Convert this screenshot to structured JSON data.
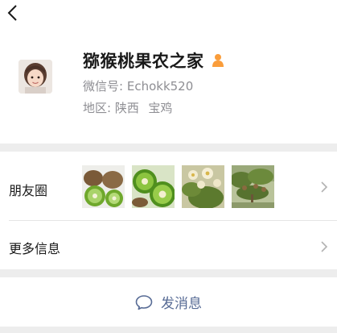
{
  "nav": {
    "back_icon": "chevron-left-icon"
  },
  "profile": {
    "name": "猕猴桃果农之家",
    "gender_icon": "person-icon",
    "gender_color": "#fa9d3b",
    "wechat_id_label": "微信号:",
    "wechat_id": "Echokk520",
    "region_label": "地区:",
    "region_province": "陕西",
    "region_city": "宝鸡"
  },
  "moments": {
    "label": "朋友圈",
    "photos": [
      "kiwi-fruit-photo",
      "kiwi-halves-photo",
      "kiwi-blossom-photo",
      "kiwi-orchard-photo"
    ]
  },
  "more_info": {
    "label": "更多信息"
  },
  "actions": {
    "send_message_label": "发消息",
    "send_message_icon": "chat-bubble-icon",
    "accent_color": "#576b95"
  }
}
